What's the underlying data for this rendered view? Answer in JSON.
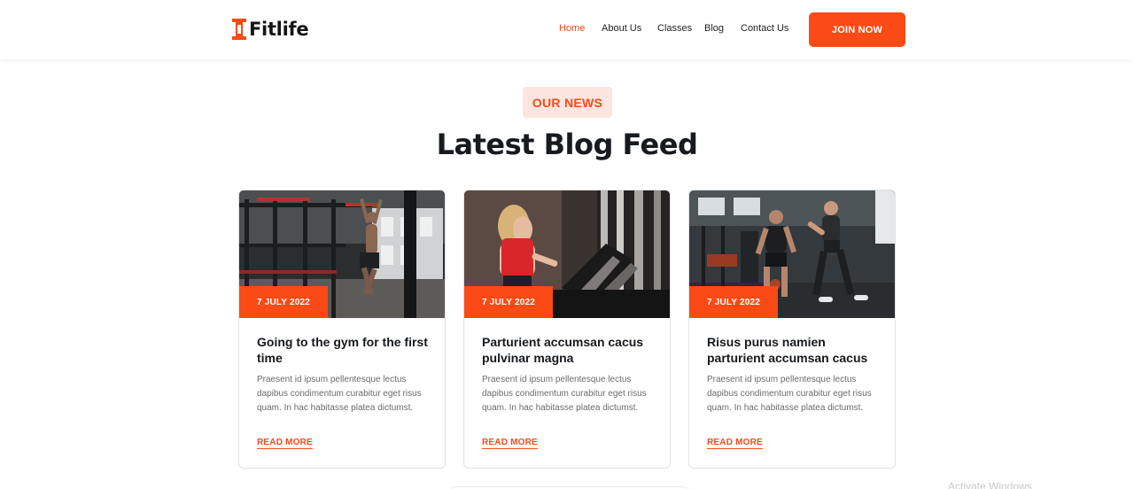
{
  "header": {
    "brand": "Fitlife",
    "logo_icon": "dumbbell-icon",
    "nav": [
      "Home",
      "About Us",
      "Classes",
      "Blog",
      "Contact Us"
    ],
    "active_nav": "Home",
    "cta_label": "JOIN NOW"
  },
  "section": {
    "eyebrow": "OUR NEWS",
    "title": "Latest Blog Feed"
  },
  "posts": [
    {
      "date": "7 JULY 2022",
      "title": "Going to the gym for the first time",
      "excerpt": "Praesent id ipsum pellentesque lectus dapibus condimentum curabitur eget risus quam. In hac habitasse platea dictumst.",
      "link_label": "READ MORE",
      "image": "man doing pull-ups in gym"
    },
    {
      "date": "7 JULY 2022",
      "title": "Parturient accumsan cacus pulvinar magna",
      "excerpt": "Praesent id ipsum pellentesque lectus dapibus condimentum curabitur eget risus quam. In hac habitasse platea dictumst.",
      "link_label": "READ MORE",
      "image": "woman running on treadmill"
    },
    {
      "date": "7 JULY 2022",
      "title": "Risus purus namien parturient accumsan cacus",
      "excerpt": "Praesent id ipsum pellentesque lectus dapibus condimentum curabitur eget risus quam. In hac habitasse platea dictumst.",
      "link_label": "READ MORE",
      "image": "couple training with kettlebell"
    }
  ],
  "watermark": "Activate Windows",
  "colors": {
    "accent": "#fb4a16",
    "accent_light": "#fde6df",
    "heading": "#171a1f"
  }
}
